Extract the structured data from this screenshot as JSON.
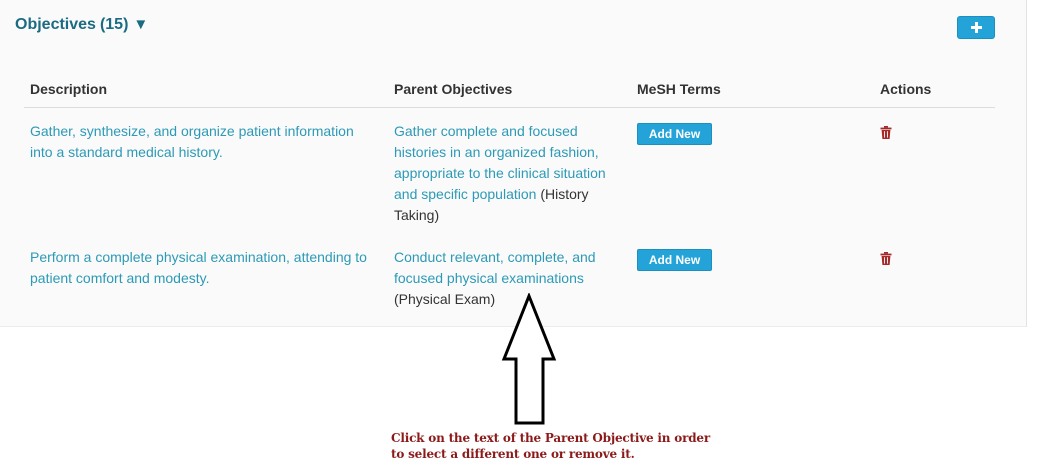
{
  "section": {
    "title": "Objectives",
    "count": "(15)",
    "caret": "▼",
    "add_icon": "plus-icon"
  },
  "table": {
    "headers": [
      "Description",
      "Parent Objectives",
      "MeSH Terms",
      "Actions"
    ],
    "rows": [
      {
        "description_lines": [
          "Gather, synthesize, and organize patient information",
          "into a standard medical history."
        ],
        "parent_link_lines": [
          "Gather complete and focused",
          "histories in an organized fashion,",
          "appropriate to the clinical situation",
          "and specific population"
        ],
        "parent_category_a": "(History",
        "parent_category_b": "Taking)",
        "mesh_button": "Add New",
        "action_icon": "trash-icon"
      },
      {
        "description_lines": [
          "Perform a complete physical examination, attending to",
          "patient comfort and modesty."
        ],
        "parent_link_lines": [
          "Conduct relevant, complete, and",
          "focused physical examinations"
        ],
        "parent_category": "(Physical Exam)",
        "mesh_button": "Add New",
        "action_icon": "trash-icon"
      }
    ]
  },
  "callout": {
    "line1": "Click on the text of the Parent Objective in order",
    "line2": "to select a different one or remove it.",
    "arrow_icon": "up-arrow-icon"
  },
  "colors": {
    "accent": "#23a3d8",
    "link": "#2c9ab7",
    "title": "#1b6b82",
    "trash": "#a52a2a",
    "callout": "#8b1a1a"
  }
}
